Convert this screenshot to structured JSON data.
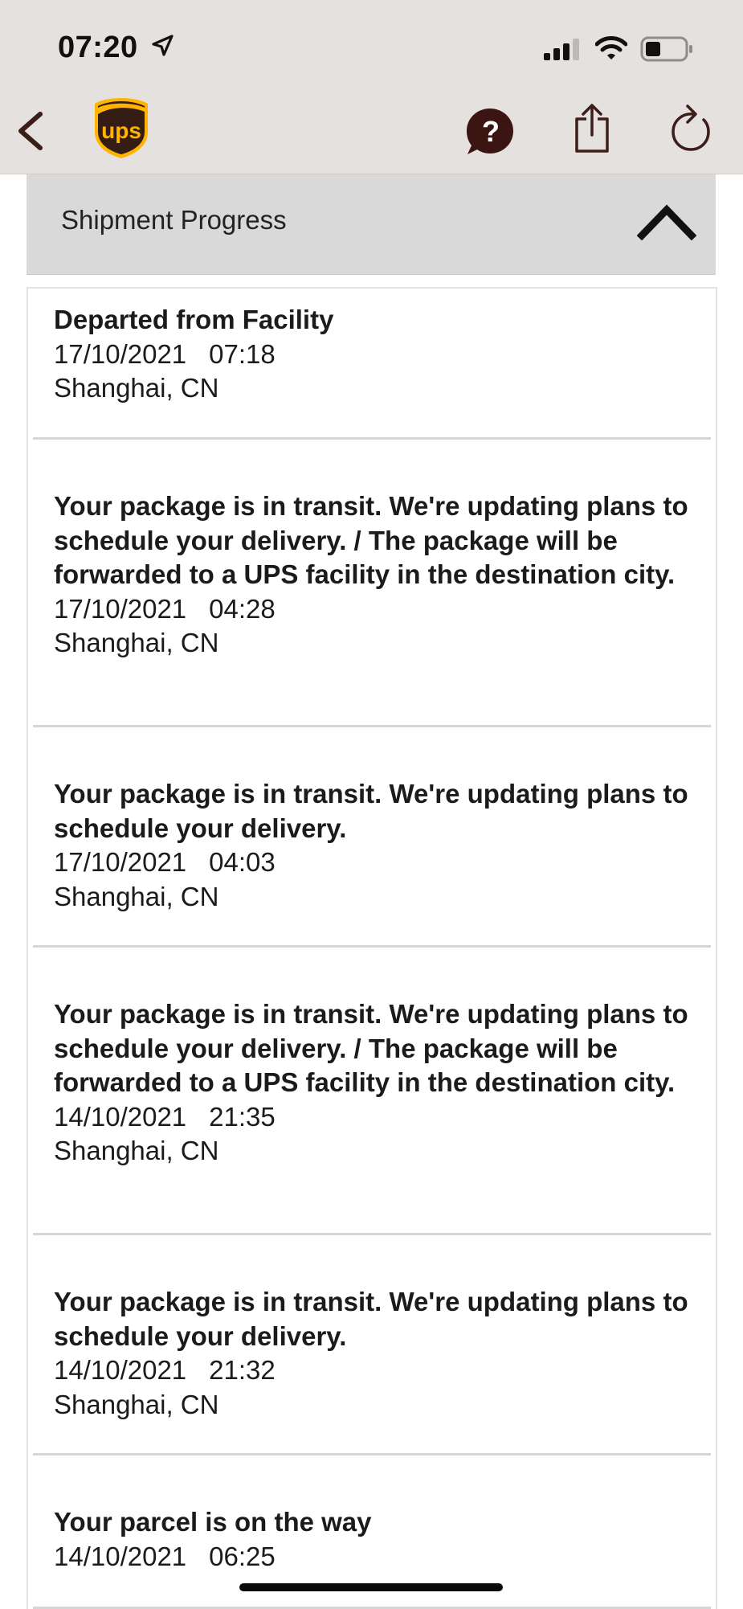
{
  "status_bar": {
    "time": "07:20"
  },
  "nav": {
    "back": "back-icon",
    "logo": "ups-logo",
    "help": "help-icon",
    "share": "share-icon",
    "refresh": "refresh-icon"
  },
  "section": {
    "title": "Shipment Progress"
  },
  "events": [
    {
      "title": "Departed from Facility",
      "date": "17/10/2021",
      "time": "07:18",
      "location": "Shanghai, CN"
    },
    {
      "title": "Your package is in transit. We're updating plans to schedule your delivery. / The package will be forwarded to a UPS facility in the destination city.",
      "date": "17/10/2021",
      "time": "04:28",
      "location": "Shanghai, CN"
    },
    {
      "title": "Your package is in transit. We're updating plans to schedule your delivery.",
      "date": "17/10/2021",
      "time": "04:03",
      "location": "Shanghai, CN"
    },
    {
      "title": "Your package is in transit. We're updating plans to schedule your delivery. / The package will be forwarded to a UPS facility in the destination city.",
      "date": "14/10/2021",
      "time": "21:35",
      "location": "Shanghai, CN"
    },
    {
      "title": "Your package is in transit. We're updating plans to schedule your delivery.",
      "date": "14/10/2021",
      "time": "21:32",
      "location": "Shanghai, CN"
    },
    {
      "title": "Your parcel is on the way",
      "date": "14/10/2021",
      "time": "06:25",
      "location": ""
    }
  ]
}
